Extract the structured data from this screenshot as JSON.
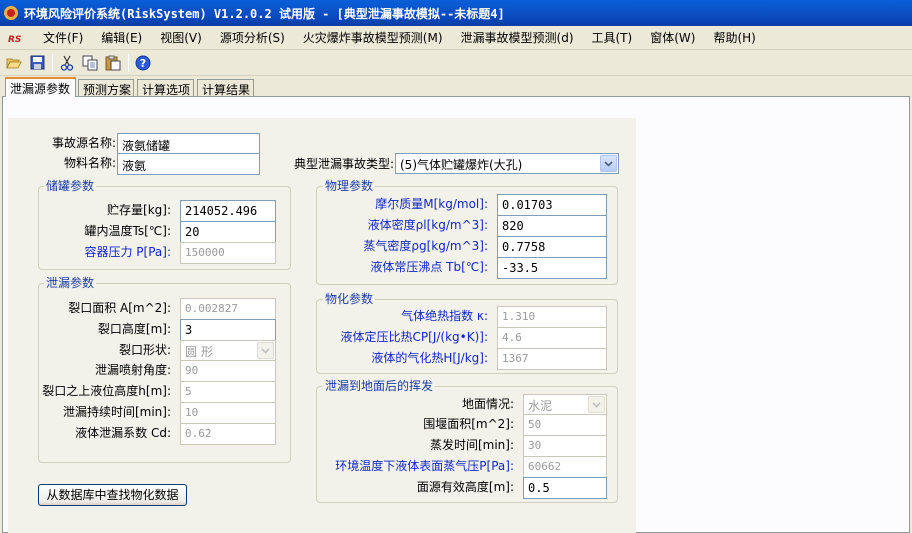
{
  "window": {
    "title": "环境风险评价系统(RiskSystem) V1.2.0.2 试用版 - [典型泄漏事故模拟--未标题4]"
  },
  "menu": [
    "文件(F)",
    "编辑(E)",
    "视图(V)",
    "源项分析(S)",
    "火灾爆炸事故模型预测(M)",
    "泄漏事故模型预测(d)",
    "工具(T)",
    "窗体(W)",
    "帮助(H)"
  ],
  "toolbar": [
    "open-icon",
    "save-icon",
    "cut-icon",
    "copy-icon",
    "paste-icon",
    "help-icon"
  ],
  "tabs": [
    "泄漏源参数",
    "预测方案",
    "计算选项",
    "计算结果"
  ],
  "form": {
    "source_name_label": "事故源名称:",
    "source_name": "液氨储罐",
    "material_label": "物料名称:",
    "material": "液氨",
    "accident_type_label": "典型泄漏事故类型:",
    "accident_type": "(5)气体贮罐爆炸(大孔)"
  },
  "tank": {
    "title": "储罐参数",
    "storage_label": "贮存量[kg]:",
    "storage": "214052.496",
    "temp_label": "罐内温度Ts[℃]:",
    "temp": "20",
    "pressure_label": "容器压力 P[Pa]:",
    "pressure": "150000"
  },
  "leak": {
    "title": "泄漏参数",
    "area_label": "裂口面积 A[m^2]:",
    "area": "0.002827",
    "height_label": "裂口高度[m]:",
    "height": "3",
    "shape_label": "裂口形状:",
    "shape": "圆 形",
    "angle_label": "泄漏喷射角度:",
    "angle": "90",
    "liquid_h_label": "裂口之上液位高度h[m]:",
    "liquid_h": "5",
    "duration_label": "泄漏持续时间[min]:",
    "duration": "10",
    "cd_label": "液体泄漏系数  Cd:",
    "cd": "0.62"
  },
  "phys": {
    "title": "物理参数",
    "molar_label": "摩尔质量M[kg/mol]:",
    "molar": "0.01703",
    "liq_density_label": "液体密度ρl[kg/m^3]:",
    "liq_density": "820",
    "vap_density_label": "蒸气密度ρg[kg/m^3]:",
    "vap_density": "0.7758",
    "boil_label": "液体常压沸点 Tb[℃]:",
    "boil": "-33.5"
  },
  "chem": {
    "title": "物化参数",
    "kappa_label": "气体绝热指数  κ:",
    "kappa": "1.310",
    "cp_label": "液体定压比热CP[J/(kg•K)]:",
    "cp": "4.6",
    "heat_label": "液体的气化热H[J/kg]:",
    "heat": "1367"
  },
  "evap": {
    "title": "泄漏到地面后的挥发",
    "ground_label": "地面情况:",
    "ground": "水泥",
    "dike_label": "围堰面积[m^2]:",
    "dike": "50",
    "evap_time_label": "蒸发时间[min]:",
    "evap_time": "30",
    "vp_label": "环境温度下液体表面蒸气压P[Pa]:",
    "vp": "60662",
    "src_h_label": "面源有效高度[m]:",
    "src_h": "0.5"
  },
  "lookup_button": "从数据库中查找物化数据",
  "colors": {
    "title_bar": "#0a4bbf",
    "blue_label": "#1028c8",
    "tab_highlight": "#e68b2c"
  }
}
